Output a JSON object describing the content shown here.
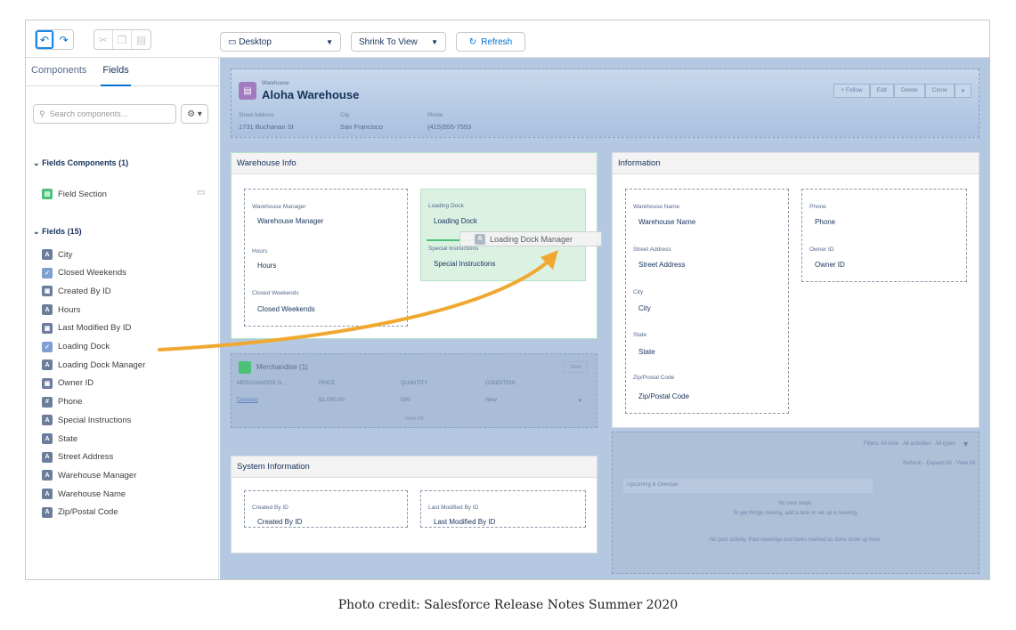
{
  "toolbar": {
    "undo_icon": "undo-icon",
    "redo_icon": "redo-icon",
    "device": "Desktop",
    "zoom": "Shrink To View",
    "refresh": "Refresh"
  },
  "left_panel": {
    "tabs": [
      "Components",
      "Fields"
    ],
    "active_tab": "Fields",
    "search_placeholder": "Search components...",
    "fields_components_header": "Fields Components (1)",
    "field_section": "Field Section",
    "fields_header": "Fields (15)",
    "fields": [
      {
        "label": "City",
        "icon": "text-icon"
      },
      {
        "label": "Closed Weekends",
        "icon": "checkbox-icon"
      },
      {
        "label": "Created By ID",
        "icon": "lookup-icon"
      },
      {
        "label": "Hours",
        "icon": "text-icon"
      },
      {
        "label": "Last Modified By ID",
        "icon": "lookup-icon"
      },
      {
        "label": "Loading Dock",
        "icon": "checkbox-icon"
      },
      {
        "label": "Loading Dock Manager",
        "icon": "text-icon"
      },
      {
        "label": "Owner ID",
        "icon": "lookup-icon"
      },
      {
        "label": "Phone",
        "icon": "number-icon"
      },
      {
        "label": "Special Instructions",
        "icon": "text-icon"
      },
      {
        "label": "State",
        "icon": "text-icon"
      },
      {
        "label": "Street Address",
        "icon": "text-icon"
      },
      {
        "label": "Warehouse Manager",
        "icon": "text-icon"
      },
      {
        "label": "Warehouse Name",
        "icon": "text-icon"
      },
      {
        "label": "Zip/Postal Code",
        "icon": "text-icon"
      }
    ]
  },
  "record": {
    "type": "Warehouse",
    "name": "Aloha Warehouse",
    "buttons": [
      "+ Follow",
      "Edit",
      "Delete",
      "Clone"
    ],
    "street_label": "Street Address",
    "street_value": "1731 Buchanan St",
    "city_label": "City",
    "city_value": "San Francisco",
    "phone_label": "Phone",
    "phone_value": "(415)555-7553"
  },
  "warehouse_info": {
    "title": "Warehouse Info",
    "fields": [
      {
        "label": "Warehouse Manager",
        "value": "Warehouse Manager"
      },
      {
        "label": "Hours",
        "value": "Hours"
      },
      {
        "label": "Closed Weekends",
        "value": "Closed Weekends"
      }
    ],
    "green_fields": [
      {
        "label": "Loading Dock",
        "value": "Loading Dock"
      },
      {
        "label": "Special Instructions",
        "value": "Special Instructions"
      }
    ],
    "drag_label": "Loading Dock Manager"
  },
  "merchandise": {
    "title": "Merchandise (1)",
    "new_label": "New",
    "columns": [
      "MERCHANDISE N...",
      "PRICE",
      "QUANTITY",
      "CONDITION"
    ],
    "row": [
      "Desktop",
      "$1,000.00",
      "500",
      "New"
    ],
    "view_all": "View All"
  },
  "system_info": {
    "title": "System Information",
    "fields": [
      {
        "label": "Created By ID",
        "value": "Created By ID"
      },
      {
        "label": "Last Modified By ID",
        "value": "Last Modified By ID"
      }
    ]
  },
  "information": {
    "title": "Information",
    "left_fields": [
      {
        "label": "Warehouse Name",
        "value": "Warehouse Name"
      },
      {
        "label": "Street Address",
        "value": "Street Address"
      },
      {
        "label": "City",
        "value": "City"
      },
      {
        "label": "State",
        "value": "State"
      },
      {
        "label": "Zip/Postal Code",
        "value": "Zip/Postal Code"
      }
    ],
    "right_fields": [
      {
        "label": "Phone",
        "value": "Phone"
      },
      {
        "label": "Owner ID",
        "value": "Owner ID"
      }
    ]
  },
  "activity": {
    "filters": "Filters: All time · All activities · All types",
    "links": "Refresh · Expand All · View All",
    "upcoming": "Upcoming & Overdue",
    "no_next": "No next steps.",
    "no_next_sub": "To get things moving, add a task or set up a meeting.",
    "no_past": "No past activity. Past meetings and tasks marked as done show up here."
  },
  "caption": "Photo credit: Salesforce Release Notes Summer 2020",
  "colors": {
    "accent": "#0070d2",
    "drag_arrow": "#f0a830",
    "green_highlight": "#dbf2e3"
  }
}
